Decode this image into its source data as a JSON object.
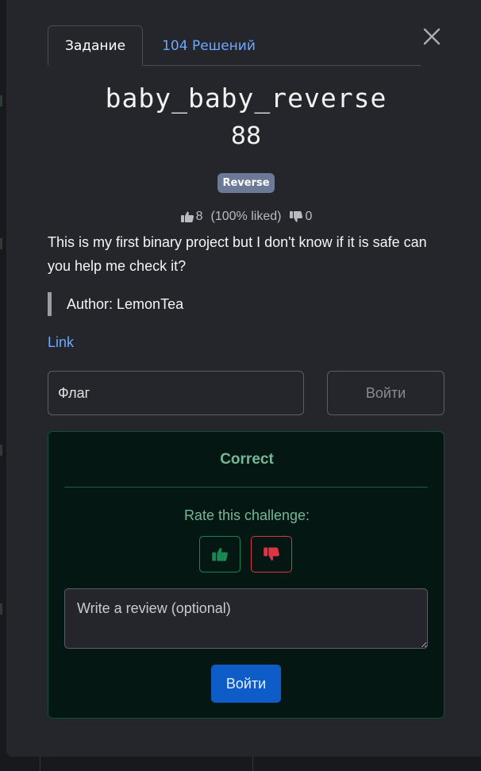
{
  "tabs": {
    "challenge": "Задание",
    "solutions": "104 Решений"
  },
  "challenge": {
    "name": "baby_baby_reverse",
    "points": "88",
    "category": "Reverse",
    "likes": "8",
    "liked_percent": "(100% liked)",
    "dislikes": "0",
    "description": "This is my first binary project but I don't know if it is safe can you help me check it?",
    "author": "Author: LemonTea",
    "link_label": "Link"
  },
  "submit": {
    "flag_placeholder": "Флаг",
    "button_label": "Войти"
  },
  "result": {
    "status": "Correct",
    "rate_label": "Rate this challenge:",
    "review_placeholder": "Write a review (optional)",
    "review_button": "Войти"
  },
  "colors": {
    "accent_link": "#6ea8fe",
    "success": "#75b798",
    "success_border": "#198754",
    "danger_border": "#dc3545",
    "primary_button": "#0d5cc7"
  },
  "icons": {
    "close": "close-icon",
    "thumbs_up": "thumbs-up-icon",
    "thumbs_down": "thumbs-down-icon"
  }
}
